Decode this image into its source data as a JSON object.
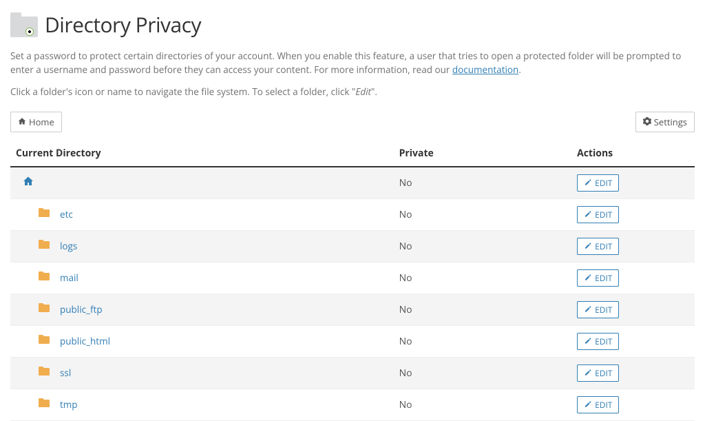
{
  "header": {
    "title": "Directory Privacy"
  },
  "description": {
    "text_before": "Set a password to protect certain directories of your account. When you enable this feature, a user that tries to open a protected folder will be prompted to enter a username and password before they can access your content. For more information, read our ",
    "link_text": "documentation",
    "text_after": "."
  },
  "instruction": {
    "text_before": "Click a folder's icon or name to navigate the file system. To select a folder, click \"",
    "emph": "Edit",
    "text_after": "\"."
  },
  "toolbar": {
    "home_label": "Home",
    "settings_label": "Settings"
  },
  "table": {
    "columns": {
      "directory": "Current Directory",
      "private": "Private",
      "actions": "Actions"
    },
    "edit_label": "EDIT",
    "rows": [
      {
        "name": "",
        "is_home": true,
        "private": "No"
      },
      {
        "name": "etc",
        "is_home": false,
        "private": "No"
      },
      {
        "name": "logs",
        "is_home": false,
        "private": "No"
      },
      {
        "name": "mail",
        "is_home": false,
        "private": "No"
      },
      {
        "name": "public_ftp",
        "is_home": false,
        "private": "No"
      },
      {
        "name": "public_html",
        "is_home": false,
        "private": "No"
      },
      {
        "name": "ssl",
        "is_home": false,
        "private": "No"
      },
      {
        "name": "tmp",
        "is_home": false,
        "private": "No"
      }
    ]
  }
}
